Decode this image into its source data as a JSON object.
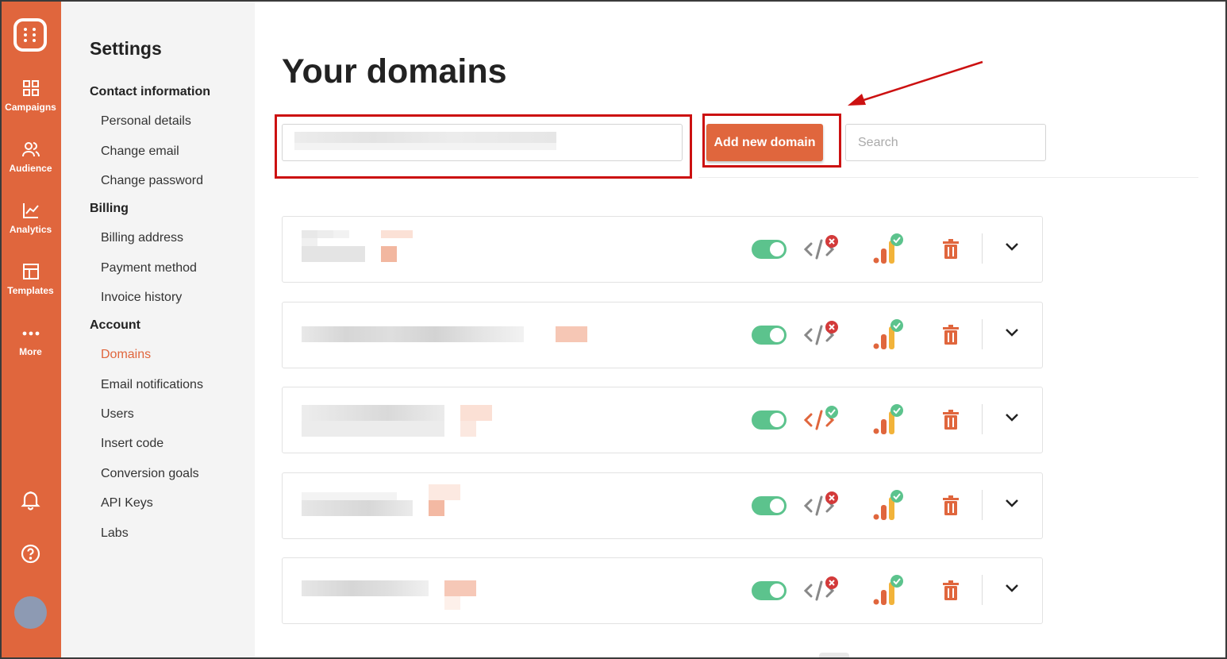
{
  "rail": {
    "items": [
      {
        "label": "Campaigns",
        "icon": "grid-icon"
      },
      {
        "label": "Audience",
        "icon": "users-icon"
      },
      {
        "label": "Analytics",
        "icon": "chart-line-icon"
      },
      {
        "label": "Templates",
        "icon": "layout-icon"
      },
      {
        "label": "More",
        "icon": "dots-icon"
      }
    ],
    "bottom_icons": [
      "bell-icon",
      "help-icon",
      "avatar"
    ],
    "color": "#e0663d"
  },
  "settings": {
    "title": "Settings",
    "sections": [
      {
        "title": "Contact information",
        "items": [
          "Personal details",
          "Change email",
          "Change password"
        ]
      },
      {
        "title": "Billing",
        "items": [
          "Billing address",
          "Payment method",
          "Invoice history"
        ]
      },
      {
        "title": "Account",
        "items": [
          "Domains",
          "Email notifications",
          "Users",
          "Insert code",
          "Conversion goals",
          "API Keys",
          "Labs"
        ]
      }
    ],
    "active_item": "Domains"
  },
  "main": {
    "title": "Your domains",
    "domain_input_value": "",
    "add_button_label": "Add new domain",
    "search_placeholder": "Search"
  },
  "domains": [
    {
      "enabled": true,
      "code_status": "error",
      "analytics_status": "ok"
    },
    {
      "enabled": true,
      "code_status": "error",
      "analytics_status": "ok"
    },
    {
      "enabled": true,
      "code_status": "ok",
      "analytics_status": "ok"
    },
    {
      "enabled": true,
      "code_status": "error",
      "analytics_status": "ok"
    },
    {
      "enabled": true,
      "code_status": "error",
      "analytics_status": "ok"
    }
  ],
  "colors": {
    "accent": "#e0663d",
    "toggle_on": "#5cc38d",
    "error": "#d33a3a",
    "ok": "#5cc38d",
    "annotation": "#cc1111"
  }
}
